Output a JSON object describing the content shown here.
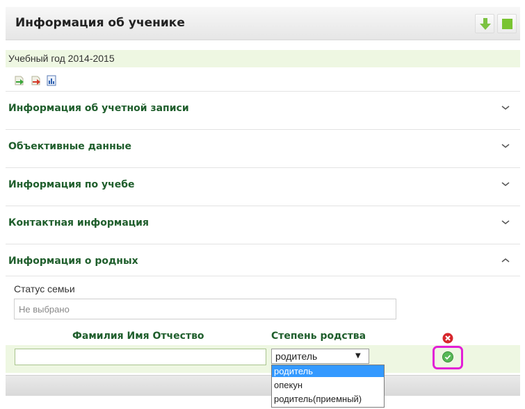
{
  "header": {
    "title": "Информация об ученике"
  },
  "year_label": "Учебный год 2014-2015",
  "toolbar_icons": [
    "export-green-icon",
    "export-red-icon",
    "report-icon"
  ],
  "sections": [
    {
      "title": "Информация об учетной записи",
      "state": "collapsed"
    },
    {
      "title": "Объективные данные",
      "state": "collapsed"
    },
    {
      "title": "Информация по учебе",
      "state": "collapsed"
    },
    {
      "title": "Контактная информация",
      "state": "collapsed"
    },
    {
      "title": "Информация о родных",
      "state": "expanded"
    }
  ],
  "family": {
    "status_label": "Статус семьи",
    "status_value": "Не выбрано",
    "col_fio": "Фамилия Имя Отчество",
    "col_relation": "Степень родства",
    "relation_selected": "родитель",
    "relation_options": [
      "родитель",
      "опекун",
      "родитель(приемный)"
    ]
  },
  "colors": {
    "accent_green": "#1f5e2c",
    "row_bg": "#eef7e2",
    "highlight": "#e21fd6",
    "selected_option": "#3399ff"
  }
}
